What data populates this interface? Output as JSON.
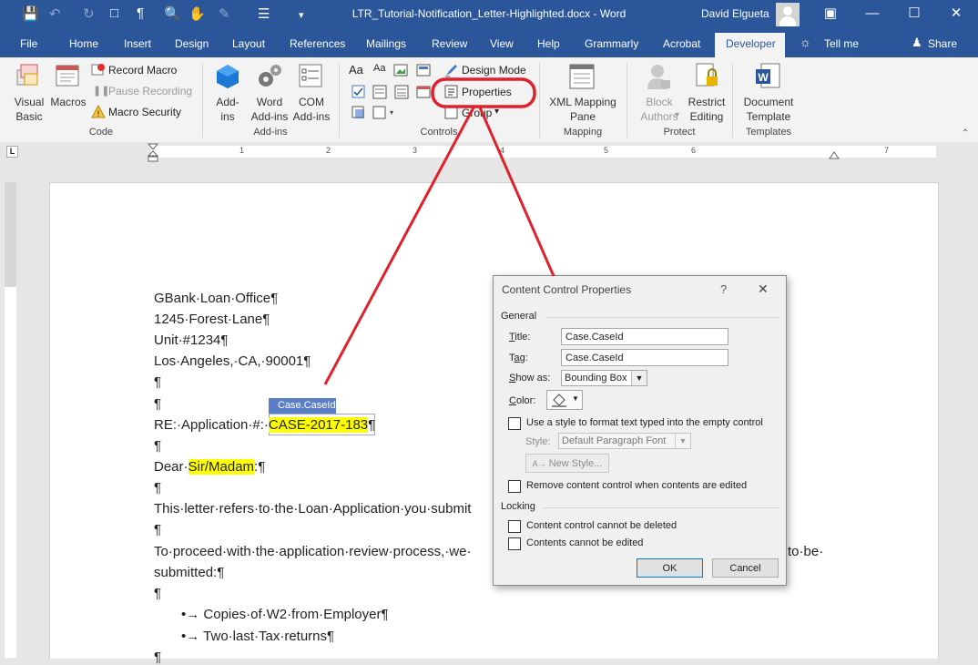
{
  "window": {
    "doc_title": "LTR_Tutorial-Notification_Letter-Highlighted.docx  -  Word",
    "user": "David Elgueta"
  },
  "tabs": [
    "File",
    "Home",
    "Insert",
    "Design",
    "Layout",
    "References",
    "Mailings",
    "Review",
    "View",
    "Help",
    "Grammarly",
    "Acrobat",
    "Developer",
    "Tell me",
    "Share"
  ],
  "active_tab": "Developer",
  "ribbon": {
    "code": {
      "visual_basic": "Visual\nBasic",
      "macros": "Macros",
      "record_macro": "Record Macro",
      "pause_recording": "Pause Recording",
      "macro_security": "Macro Security",
      "group": "Code"
    },
    "addins": {
      "addins": "Add-\nins",
      "word_addins": "Word\nAdd-ins",
      "com_addins": "COM\nAdd-ins",
      "group": "Add-ins"
    },
    "controls": {
      "design_mode": "Design Mode",
      "properties": "Properties",
      "group_btn": "Group",
      "group": "Controls"
    },
    "mapping": {
      "xml_mapping": "XML Mapping\nPane",
      "group": "Mapping"
    },
    "protect": {
      "block_authors": "Block\nAuthors",
      "restrict_editing": "Restrict\nEditing",
      "group": "Protect"
    },
    "templates": {
      "document_template": "Document\nTemplate",
      "group": "Templates"
    }
  },
  "ruler": {
    "numbers": [
      "1",
      "2",
      "3",
      "4",
      "5",
      "6",
      "7"
    ]
  },
  "document": {
    "lines": {
      "l1": "GBank·Loan·Office¶",
      "l2": "1245·Forest·Lane¶",
      "l3": "Unit·#1234¶",
      "l4": "Los·Angeles,·CA,·90001¶",
      "l5": "¶",
      "l6": "¶",
      "re_prefix": "RE:·Application·#:·",
      "re_value": "CASE-2017-183",
      "re_suffix": "¶",
      "l8": "¶",
      "dear_prefix": "Dear·",
      "dear_value": "Sir/Madam",
      "dear_suffix": ":¶",
      "l10": "¶",
      "l11": "This·letter·refers·to·the·Loan·Application·you·submit",
      "l12": "¶",
      "l13a": "To·proceed·with·the·application·review·process,·we·",
      "l13b": "to·be·",
      "l14": "submitted:¶",
      "l15": "¶",
      "b1": "•→ Copies·of·W2·from·Employer¶",
      "b2": "•→ Two·last·Tax·returns¶",
      "l18": "¶"
    },
    "content_control_tag": "Case.CaseId"
  },
  "dialog": {
    "title": "Content Control Properties",
    "help": "?",
    "close": "✕",
    "general": "General",
    "title_label": "Title:",
    "title_value": "Case.CaseId",
    "tag_label": "Tag:",
    "tag_value": "Case.CaseId",
    "show_as_label": "Show as:",
    "show_as_value": "Bounding Box",
    "color_label": "Color:",
    "use_style": "Use a style to format text typed into the empty control",
    "style_label": "Style:",
    "style_value": "Default Paragraph Font",
    "new_style": "New Style...",
    "remove_cc": "Remove content control when contents are edited",
    "locking": "Locking",
    "cannot_delete": "Content control cannot be deleted",
    "cannot_edit": "Contents cannot be edited",
    "ok": "OK",
    "cancel": "Cancel"
  },
  "colors": {
    "title_bar": "#2b579a",
    "annotation": "#e0202a",
    "highlight": "#ffff00"
  }
}
